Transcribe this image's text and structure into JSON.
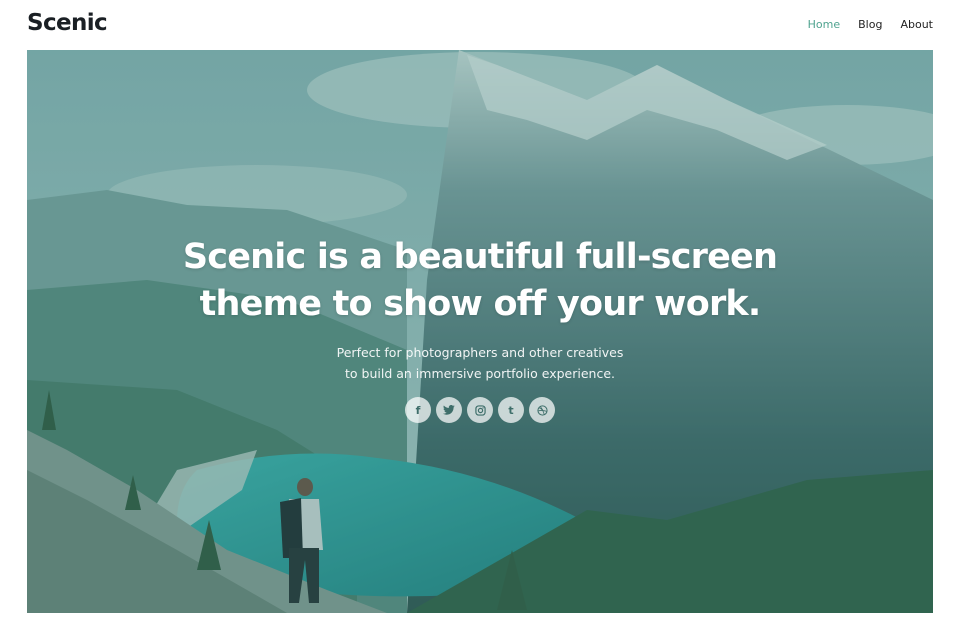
{
  "site": {
    "logo": "Scenic"
  },
  "nav": {
    "items": [
      {
        "label": "Home",
        "active": true
      },
      {
        "label": "Blog"
      },
      {
        "label": "About"
      }
    ]
  },
  "hero": {
    "headline_line1": "Scenic is a beautiful full-screen",
    "headline_line2": "theme to show off your work.",
    "sub_line1": "Perfect for photographers and other creatives",
    "sub_line2": "to build an immersive portfolio experience.",
    "image": "mountain-lake-hiker-photo"
  },
  "social": [
    {
      "icon": "facebook-icon",
      "glyph": "f"
    },
    {
      "icon": "twitter-icon",
      "glyph": "🐦"
    },
    {
      "icon": "instagram-icon",
      "glyph": "◎"
    },
    {
      "icon": "tumblr-icon",
      "glyph": "t"
    },
    {
      "icon": "dribbble-icon",
      "glyph": "⊛"
    }
  ],
  "colors": {
    "accent": "#4fa38f",
    "overlay": "#347d76",
    "text_dark": "#1a1f24"
  }
}
